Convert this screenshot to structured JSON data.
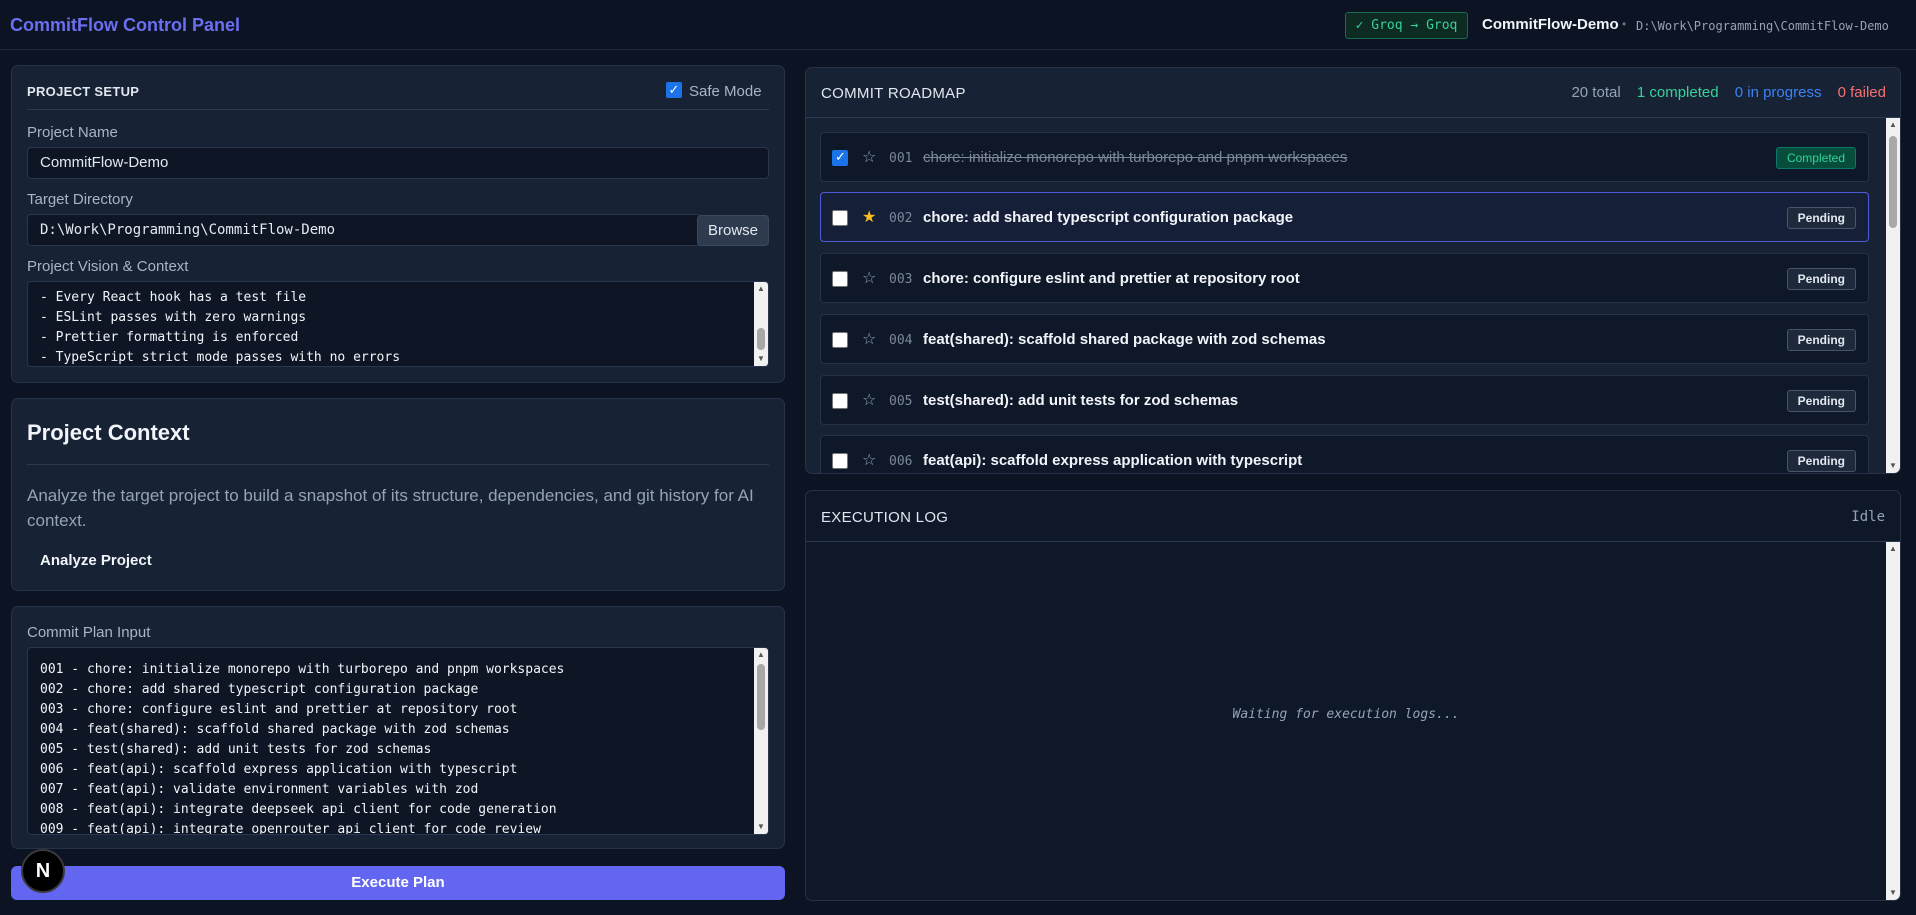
{
  "header": {
    "app_title": "CommitFlow Control Panel",
    "provider_badge": "✓ Groq → Groq",
    "project_name": "CommitFlow-Demo",
    "separator": "•",
    "project_path": "D:\\Work\\Programming\\CommitFlow-Demo"
  },
  "setup": {
    "title": "PROJECT SETUP",
    "safe_mode_label": "Safe Mode",
    "safe_mode_checked": true,
    "project_name_label": "Project Name",
    "project_name_value": "CommitFlow-Demo",
    "target_dir_label": "Target Directory",
    "target_dir_value": "D:\\Work\\Programming\\CommitFlow-Demo",
    "browse_label": "Browse",
    "vision_label": "Project Vision & Context",
    "vision_lines": [
      "- Every React hook has a test file",
      "- ESLint passes with zero warnings",
      "- Prettier formatting is enforced",
      "- TypeScript strict mode passes with no errors"
    ]
  },
  "context": {
    "title": "Project Context",
    "description": "Analyze the target project to build a snapshot of its structure, dependencies, and git history for AI context.",
    "analyze_label": "Analyze Project"
  },
  "plan": {
    "label": "Commit Plan Input",
    "lines": [
      "001 - chore: initialize monorepo with turborepo and pnpm workspaces",
      "002 - chore: add shared typescript configuration package",
      "003 - chore: configure eslint and prettier at repository root",
      "004 - feat(shared): scaffold shared package with zod schemas",
      "005 - test(shared): add unit tests for zod schemas",
      "006 - feat(api): scaffold express application with typescript",
      "007 - feat(api): validate environment variables with zod",
      "008 - feat(api): integrate deepseek api client for code generation",
      "009 - feat(api): integrate openrouter api client for code review"
    ],
    "execute_label": "Execute Plan"
  },
  "roadmap": {
    "title": "COMMIT ROADMAP",
    "stats": {
      "total": "20 total",
      "completed": "1 completed",
      "in_progress": "0 in progress",
      "failed": "0 failed"
    },
    "rows": [
      {
        "num": "001",
        "message": "chore: initialize monorepo with turborepo and pnpm workspaces",
        "status": "Completed",
        "checked": true,
        "starred": false
      },
      {
        "num": "002",
        "message": "chore: add shared typescript configuration package",
        "status": "Pending",
        "checked": false,
        "starred": true
      },
      {
        "num": "003",
        "message": "chore: configure eslint and prettier at repository root",
        "status": "Pending",
        "checked": false,
        "starred": false
      },
      {
        "num": "004",
        "message": "feat(shared): scaffold shared package with zod schemas",
        "status": "Pending",
        "checked": false,
        "starred": false
      },
      {
        "num": "005",
        "message": "test(shared): add unit tests for zod schemas",
        "status": "Pending",
        "checked": false,
        "starred": false
      },
      {
        "num": "006",
        "message": "feat(api): scaffold express application with typescript",
        "status": "Pending",
        "checked": false,
        "starred": false
      }
    ]
  },
  "log": {
    "title": "EXECUTION LOG",
    "status": "Idle",
    "placeholder": "Waiting for execution logs..."
  },
  "devtools": {
    "badge_letter": "N"
  },
  "colors": {
    "accent": "#6366f1",
    "completed_green": "#34d399",
    "in_progress_blue": "#3b82f6",
    "failed_red": "#f87171",
    "star_yellow": "#fbbf24"
  }
}
